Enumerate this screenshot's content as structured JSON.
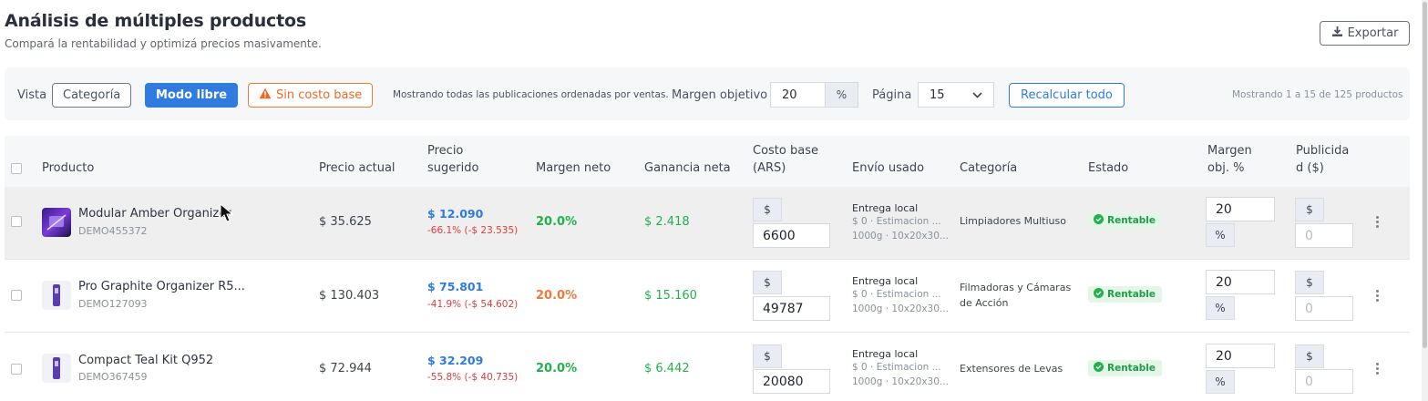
{
  "header": {
    "title": "Análisis de múltiples productos",
    "subtitle": "Compará la rentabilidad y optimizá precios masivamente.",
    "export_label": "Exportar"
  },
  "toolbar": {
    "view_label": "Vista",
    "category_btn": "Categoría",
    "free_mode_btn": "Modo libre",
    "no_cost_btn": "Sin costo base",
    "note": "Mostrando todas las publicaciones ordenadas por ventas.",
    "target_margin_label": "Margen objetivo",
    "target_margin_value": "20",
    "target_margin_unit": "%",
    "page_label": "Página",
    "page_size_value": "15",
    "recalc_btn": "Recalcular todo",
    "showing_text": "Mostrando 1 a 15 de 125 productos"
  },
  "table": {
    "headers": {
      "product": "Producto",
      "current_price": "Precio actual",
      "suggested_price_1": "Precio",
      "suggested_price_2": "sugerido",
      "net_margin": "Margen neto",
      "net_gain": "Ganancia neta",
      "base_cost_1": "Costo base",
      "base_cost_2": "(ARS)",
      "shipping": "Envío usado",
      "category": "Categoría",
      "status": "Estado",
      "target_margin_1": "Margen",
      "target_margin_2": "obj. %",
      "advertised_1": "Publicida",
      "advertised_2": "d ($)"
    },
    "rows": [
      {
        "name": "Modular Amber Organizer",
        "sku": "DEMO455372",
        "current_price": "$ 35.625",
        "suggested_price": "$ 12.090",
        "suggested_diff": "-66.1% (-$ 23.535)",
        "net_margin": "20.0%",
        "net_gain": "$ 2.418",
        "currency_addon": "$",
        "base_cost": "6600",
        "ship_method": "Entrega local",
        "ship_cost": "$ 0 · Estimacion ...",
        "ship_dims": "1000g · 10x20x30...",
        "category": "Limpiadores Multiuso",
        "status": "Rentable",
        "target_margin": "20",
        "pct_addon": "%",
        "ad_addon": "$",
        "ad_placeholder": "0"
      },
      {
        "name": "Pro Graphite Organizer R5...",
        "sku": "DEMO127093",
        "current_price": "$ 130.403",
        "suggested_price": "$ 75.801",
        "suggested_diff": "-41.9% (-$ 54.602)",
        "net_margin": "20.0%",
        "net_gain": "$ 15.160",
        "currency_addon": "$",
        "base_cost": "49787",
        "ship_method": "Entrega local",
        "ship_cost": "$ 0 · Estimacion ...",
        "ship_dims": "1000g · 10x20x30...",
        "category": "Filmadoras y Cámaras de Acción",
        "status": "Rentable",
        "target_margin": "20",
        "pct_addon": "%",
        "ad_addon": "$",
        "ad_placeholder": "0"
      },
      {
        "name": "Compact Teal Kit Q952",
        "sku": "DEMO367459",
        "current_price": "$ 72.944",
        "suggested_price": "$ 32.209",
        "suggested_diff": "-55.8% (-$ 40.735)",
        "net_margin": "20.0%",
        "net_gain": "$ 6.442",
        "currency_addon": "$",
        "base_cost": "20080",
        "ship_method": "Entrega local",
        "ship_cost": "$ 0 · Estimacion ...",
        "ship_dims": "1000g · 10x20x30...",
        "category": "Extensores de Levas",
        "status": "Rentable",
        "target_margin": "20",
        "pct_addon": "%",
        "ad_addon": "$",
        "ad_placeholder": "0"
      }
    ]
  },
  "colors": {
    "primary": "#2f7be0",
    "warning": "#ec6a24",
    "success": "#22b04b",
    "danger": "#e03b3b"
  }
}
